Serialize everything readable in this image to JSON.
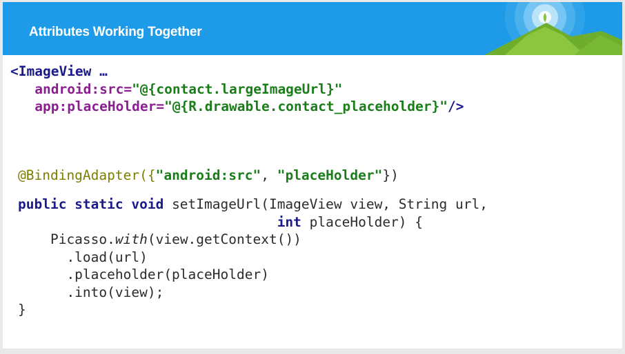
{
  "slide": {
    "title": "Attributes Working Together"
  },
  "xml_code": {
    "tag_open": "<ImageView …",
    "src_attr": "android:src=",
    "src_value": "\"@{contact.largeImageUrl}\"",
    "placeholder_attr": "app:placeHolder=",
    "placeholder_value": "\"@{R.drawable.contact_placeholder}\"",
    "tag_close": "/>"
  },
  "java_code": {
    "annotation": "@BindingAdapter({",
    "annotation_arg1": "\"android:src\"",
    "annotation_sep": ", ",
    "annotation_arg2": "\"placeHolder\"",
    "annotation_end": "})",
    "sig_keywords": "public static void",
    "sig_rest": " setImageUrl(ImageView view, String url,",
    "sig_indent_kw": "int",
    "sig_line2_rest": " placeHolder) {",
    "picasso_prefix": "    Picasso.",
    "picasso_with": "with",
    "picasso_suffix": "(view.getContext())",
    "load_line": "      .load(url)",
    "placeholder_line": "      .placeholder(placeHolder)",
    "into_line": "      .into(view);",
    "closing_brace": "}"
  },
  "colors": {
    "header": "#1e9be8",
    "keyword": "#1a1a8c",
    "attribute": "#8a1f8f",
    "string": "#1a7d1a",
    "annotation": "#7d7d00"
  }
}
